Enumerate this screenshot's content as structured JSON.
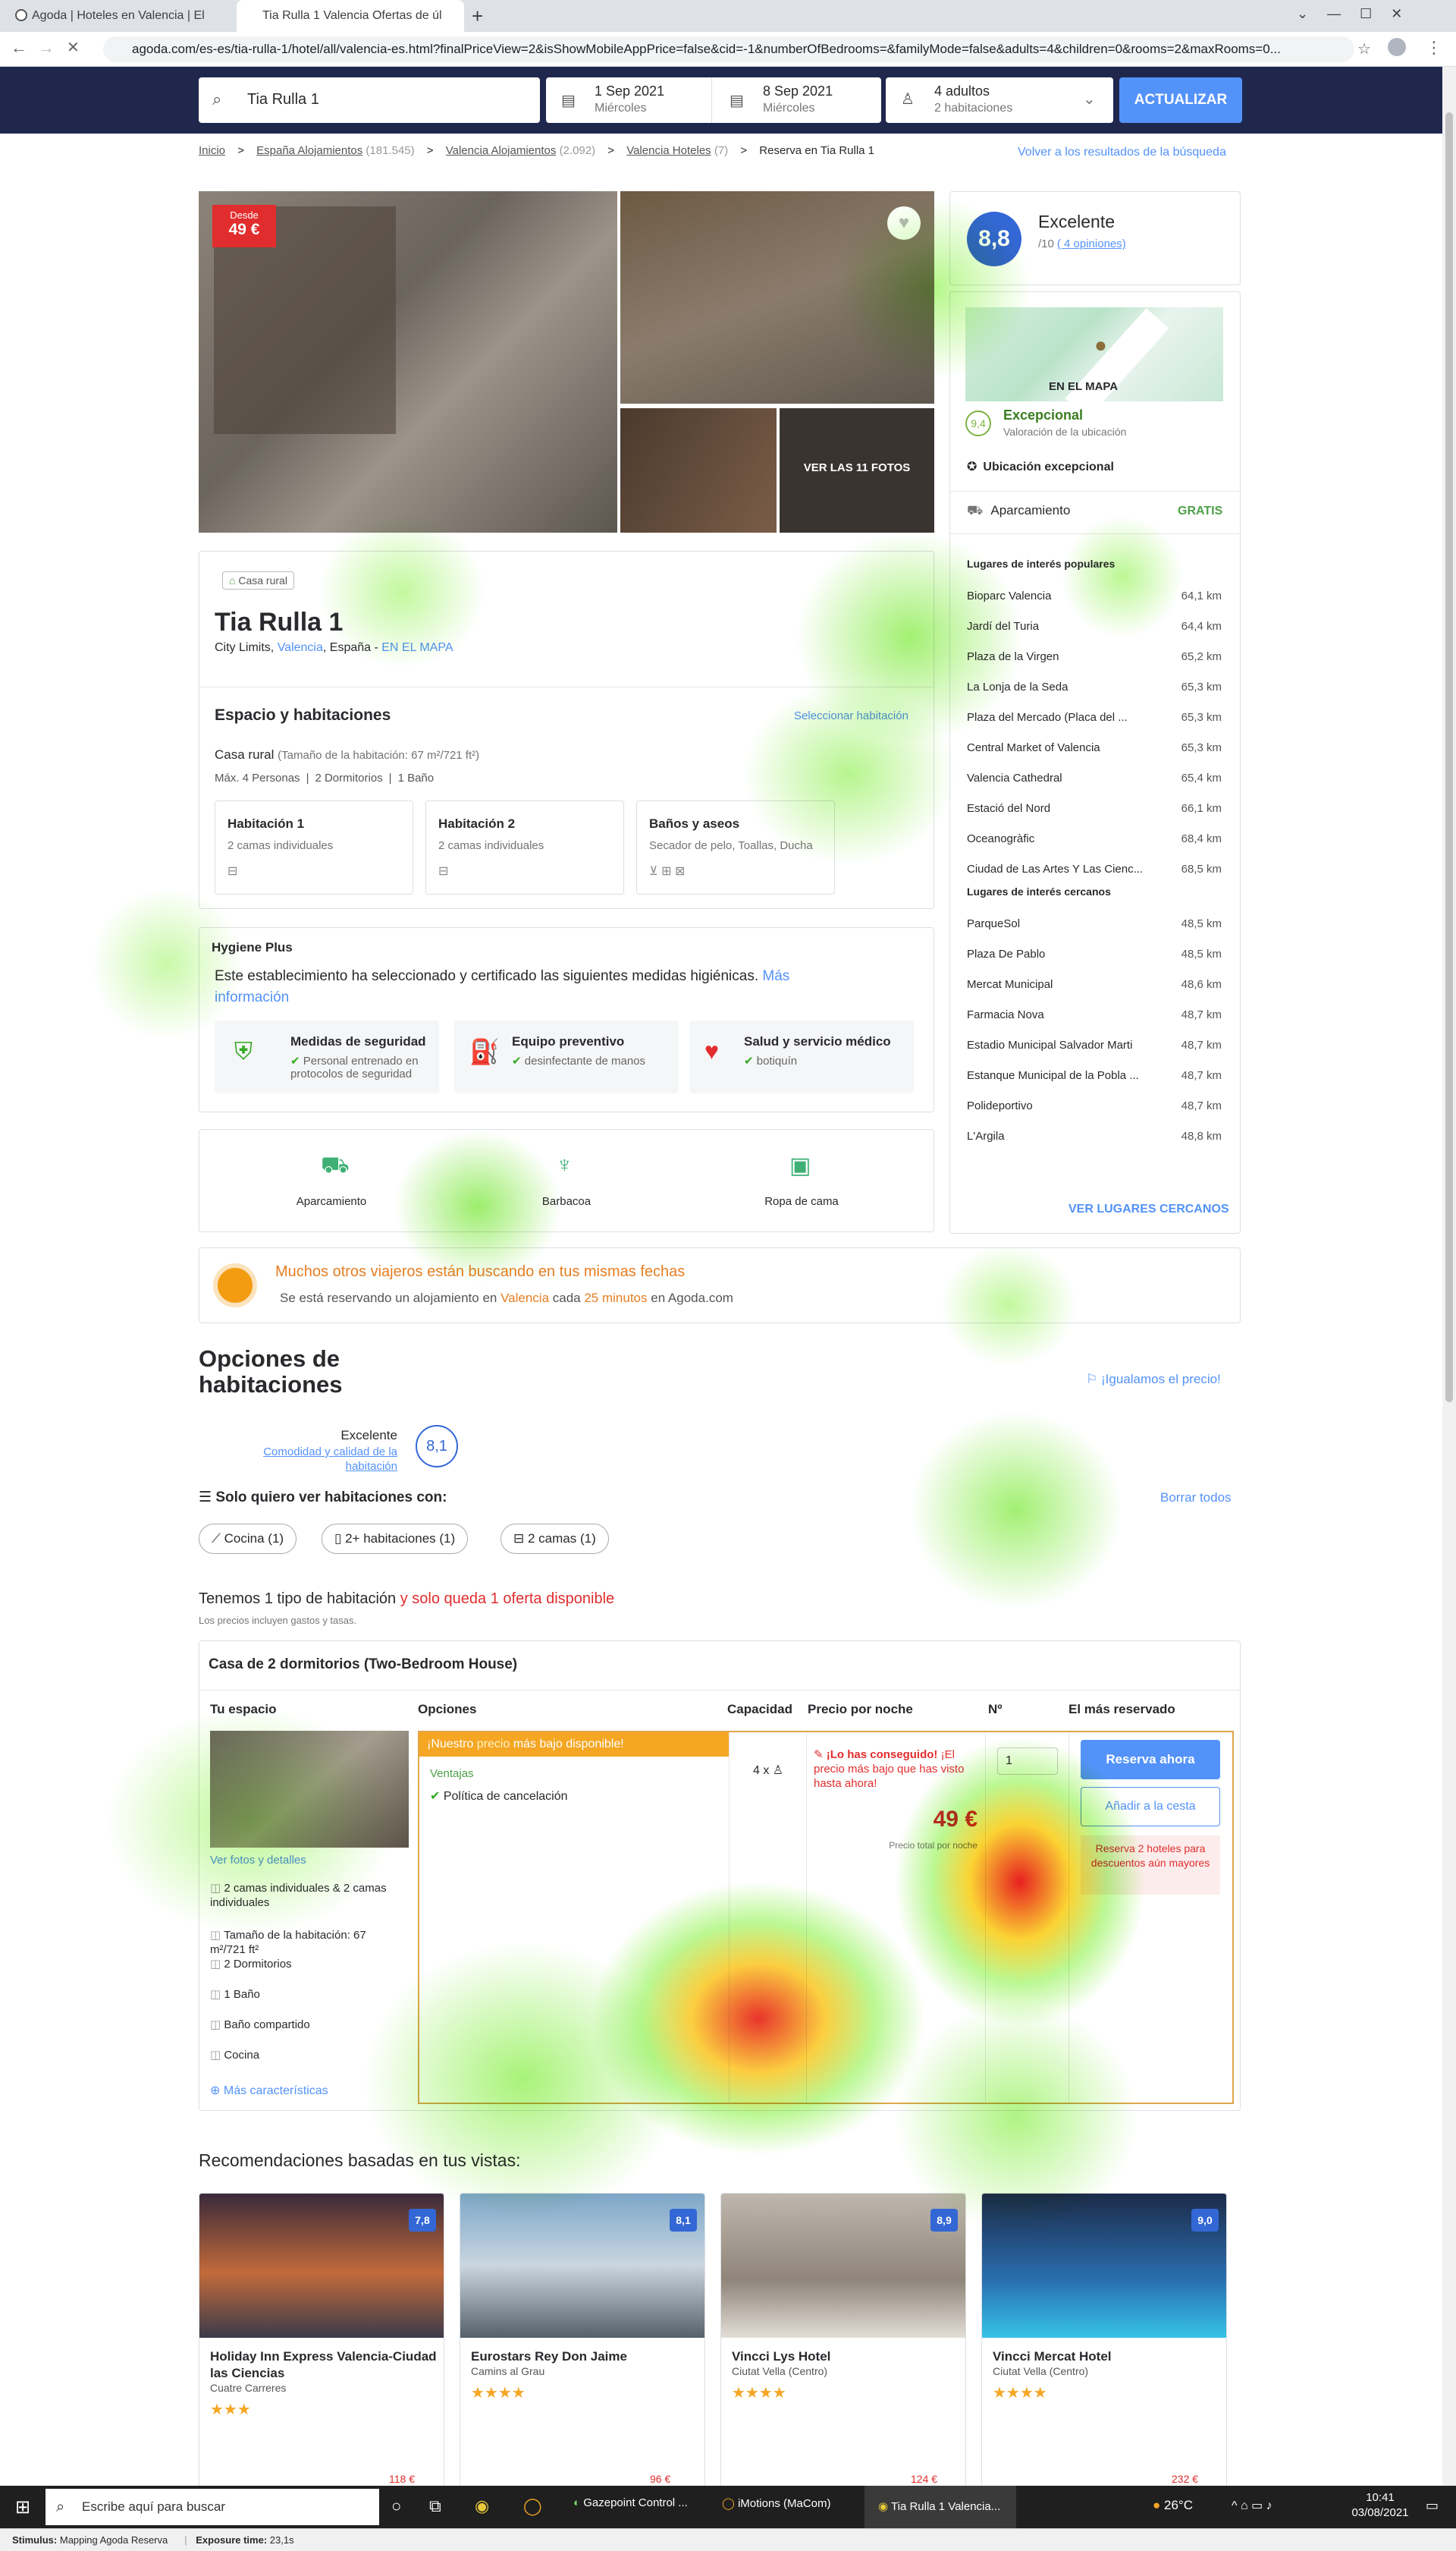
{
  "browser": {
    "tabs": [
      "Agoda | Hoteles en Valencia | El",
      "Tia Rulla 1 Valencia Ofertas de úl"
    ],
    "url": "agoda.com/es-es/tia-rulla-1/hotel/all/valencia-es.html?finalPriceView=2&isShowMobileAppPrice=false&cid=-1&numberOfBedrooms=&familyMode=false&adults=4&children=0&rooms=2&maxRooms=0..."
  },
  "search": {
    "query": "Tia Rulla 1",
    "checkin_date": "1 Sep 2021",
    "checkin_day": "Miércoles",
    "checkout_date": "8 Sep 2021",
    "checkout_day": "Miércoles",
    "guests": "4 adultos",
    "rooms": "2 habitaciones",
    "update_label": "ACTUALIZAR"
  },
  "breadcrumb": {
    "items": [
      "Inicio",
      "España Alojamientos",
      "Valencia Alojamientos",
      "Valencia Hoteles",
      "Reserva en Tia Rulla 1"
    ],
    "counts": [
      "(181.545)",
      "(2.092)",
      "(7)"
    ],
    "back_link": "Volver a los resultados de la búsqueda"
  },
  "gallery": {
    "from_label": "Desde",
    "from_price": "49 €",
    "see_photos": "VER LAS 11 FOTOS"
  },
  "rating": {
    "score": "8,8",
    "label": "Excelente",
    "scale": "/10",
    "reviews": "( 4 opiniones)"
  },
  "map": {
    "label": "EN EL MAPA",
    "loc_score": "9,4",
    "loc_title": "Excepcional",
    "loc_sub": "Valoración de la ubicación",
    "badge": "Ubicación excepcional",
    "parking": "Aparcamiento",
    "parking_tag": "GRATIS"
  },
  "pois_popular": {
    "title": "Lugares de interés populares",
    "items": [
      [
        "Bioparc Valencia",
        "64,1 km"
      ],
      [
        "Jardí del Turia",
        "64,4 km"
      ],
      [
        "Plaza de la Virgen",
        "65,2 km"
      ],
      [
        "La Lonja de la Seda",
        "65,3 km"
      ],
      [
        "Plaza del Mercado (Placa del ...",
        "65,3 km"
      ],
      [
        "Central Market of Valencia",
        "65,3 km"
      ],
      [
        "Valencia Cathedral",
        "65,4 km"
      ],
      [
        "Estació del Nord",
        "66,1 km"
      ],
      [
        "Oceanogràfic",
        "68,4 km"
      ],
      [
        "Ciudad de Las Artes Y Las Cienc...",
        "68,5 km"
      ]
    ]
  },
  "pois_near": {
    "title": "Lugares de interés cercanos",
    "items": [
      [
        "ParqueSol",
        "48,5 km"
      ],
      [
        "Plaza De Pablo",
        "48,5 km"
      ],
      [
        "Mercat Municipal",
        "48,6 km"
      ],
      [
        "Farmacia Nova",
        "48,7 km"
      ],
      [
        "Estadio Municipal Salvador Marti",
        "48,7 km"
      ],
      [
        "Estanque Municipal de la Pobla ...",
        "48,7 km"
      ],
      [
        "Polideportivo",
        "48,7 km"
      ],
      [
        "L'Argila",
        "48,8 km"
      ]
    ],
    "more": "VER LUGARES CERCANOS"
  },
  "hotel": {
    "type": "Casa rural",
    "name": "Tia Rulla 1",
    "loc_a": "City Limits,",
    "loc_b": "Valencia",
    "loc_c": ", España - ",
    "map_link": "EN EL MAPA"
  },
  "space": {
    "title": "Espacio y habitaciones",
    "select": "Seleccionar habitación",
    "type": "Casa rural",
    "size": "(Tamaño de la habitación: 67 m²/721 ft²)",
    "facts": [
      "Máx. 4 Personas",
      "2 Dormitorios",
      "1 Baño"
    ],
    "rooms": [
      [
        "Habitación 1",
        "2 camas individuales"
      ],
      [
        "Habitación 2",
        "2 camas individuales"
      ],
      [
        "Baños y aseos",
        "Secador de pelo, Toallas, Ducha"
      ]
    ]
  },
  "hygiene": {
    "title": "Hygiene Plus",
    "text": "Este establecimiento ha seleccionado y certificado las siguientes medidas higiénicas.",
    "more1": "Más",
    "more2": "información",
    "items": [
      [
        "Medidas de seguridad",
        "Personal entrenado en protocolos de seguridad"
      ],
      [
        "Equipo preventivo",
        "desinfectante de manos"
      ],
      [
        "Salud y servicio médico",
        "botiquín"
      ]
    ]
  },
  "amenities": [
    "Aparcamiento",
    "Barbacoa",
    "Ropa de cama"
  ],
  "demand": {
    "title": "Muchos otros viajeros están buscando en tus mismas fechas",
    "sub_a": "Se está reservando un alojamiento en ",
    "sub_b": "Valencia",
    "sub_c": " cada ",
    "sub_d": "25 minutos",
    "sub_e": " en Agoda.com"
  },
  "options": {
    "title1": "Opciones de",
    "title2": "habitaciones",
    "match": "¡Igualamos el precio!",
    "score_label": "Excelente",
    "score_sub1": "Comodidad y calidad de la",
    "score_sub2": "habitación",
    "score": "8,1",
    "filter_title": "Solo quiero ver habitaciones con:",
    "clear": "Borrar todos",
    "chips": [
      "Cocina (1)",
      "2+ habitaciones (1)",
      "2 camas (1)"
    ],
    "summary_a": "Tenemos 1 tipo de habitación",
    "summary_b": " y solo queda 1 oferta disponible",
    "taxes": "Los precios incluyen gastos y tasas."
  },
  "room": {
    "name": "Casa de 2 dormitorios (Two-Bedroom House)",
    "cols": [
      "Tu espacio",
      "Opciones",
      "Capacidad",
      "Precio por noche",
      "Nº",
      "El más reservado"
    ],
    "photos_link": "Ver fotos y detalles",
    "features": [
      "2 camas individuales & 2 camas individuales",
      "Tamaño de la habitación: 67 m²/721 ft²",
      "2 Dormitorios",
      "1 Baño",
      "Baño compartido",
      "Cocina"
    ],
    "more": "Más características",
    "deal_a": "¡Nuestro ",
    "deal_b": "precio",
    "deal_c": " más bajo disponible!",
    "perks": "Ventajas",
    "cancel": "Política de cancelación",
    "cap": "4 x",
    "got_a": "¡Lo has conseguido!",
    "got_b": " ¡El precio más bajo que has visto hasta ahora!",
    "price": "49 €",
    "price_sub": "Precio total por noche",
    "qty": "1",
    "book": "Reserva ahora",
    "cart": "Añadir a la cesta",
    "promo": "Reserva 2 hoteles para descuentos aún mayores"
  },
  "recs": {
    "title": "Recomendaciones basadas en tus vistas:",
    "items": [
      {
        "name": "Holiday Inn Express Valencia-Ciudad las Ciencias",
        "area": "Cuatre Carreres",
        "score": "7,8",
        "stars": "★★★",
        "price": "118 €"
      },
      {
        "name": "Eurostars Rey Don Jaime",
        "area": "Camins al Grau",
        "score": "8,1",
        "stars": "★★★★",
        "price": "96 €"
      },
      {
        "name": "Vincci Lys Hotel",
        "area": "Ciutat Vella (Centro)",
        "score": "8,9",
        "stars": "★★★★",
        "price": "124 €"
      },
      {
        "name": "Vincci Mercat Hotel",
        "area": "Ciutat Vella (Centro)",
        "score": "9,0",
        "stars": "★★★★",
        "price": "232 €"
      }
    ]
  },
  "taskbar": {
    "search": "Escribe aquí para buscar",
    "apps": [
      "Gazepoint Control ...",
      "iMotions (MaCom)",
      "Tia Rulla 1 Valencia..."
    ],
    "temp": "26°C",
    "time": "10:41",
    "date": "03/08/2021"
  },
  "footer": {
    "stim_label": "Stimulus:",
    "stim": "Mapping Agoda Reserva",
    "exp_label": "Exposure time:",
    "exp": "23,1s"
  },
  "colors": {
    "brand": "#20274d",
    "accent": "#5392f9",
    "orange": "#e67e22",
    "red": "#e12d2d",
    "green": "#32a923"
  }
}
